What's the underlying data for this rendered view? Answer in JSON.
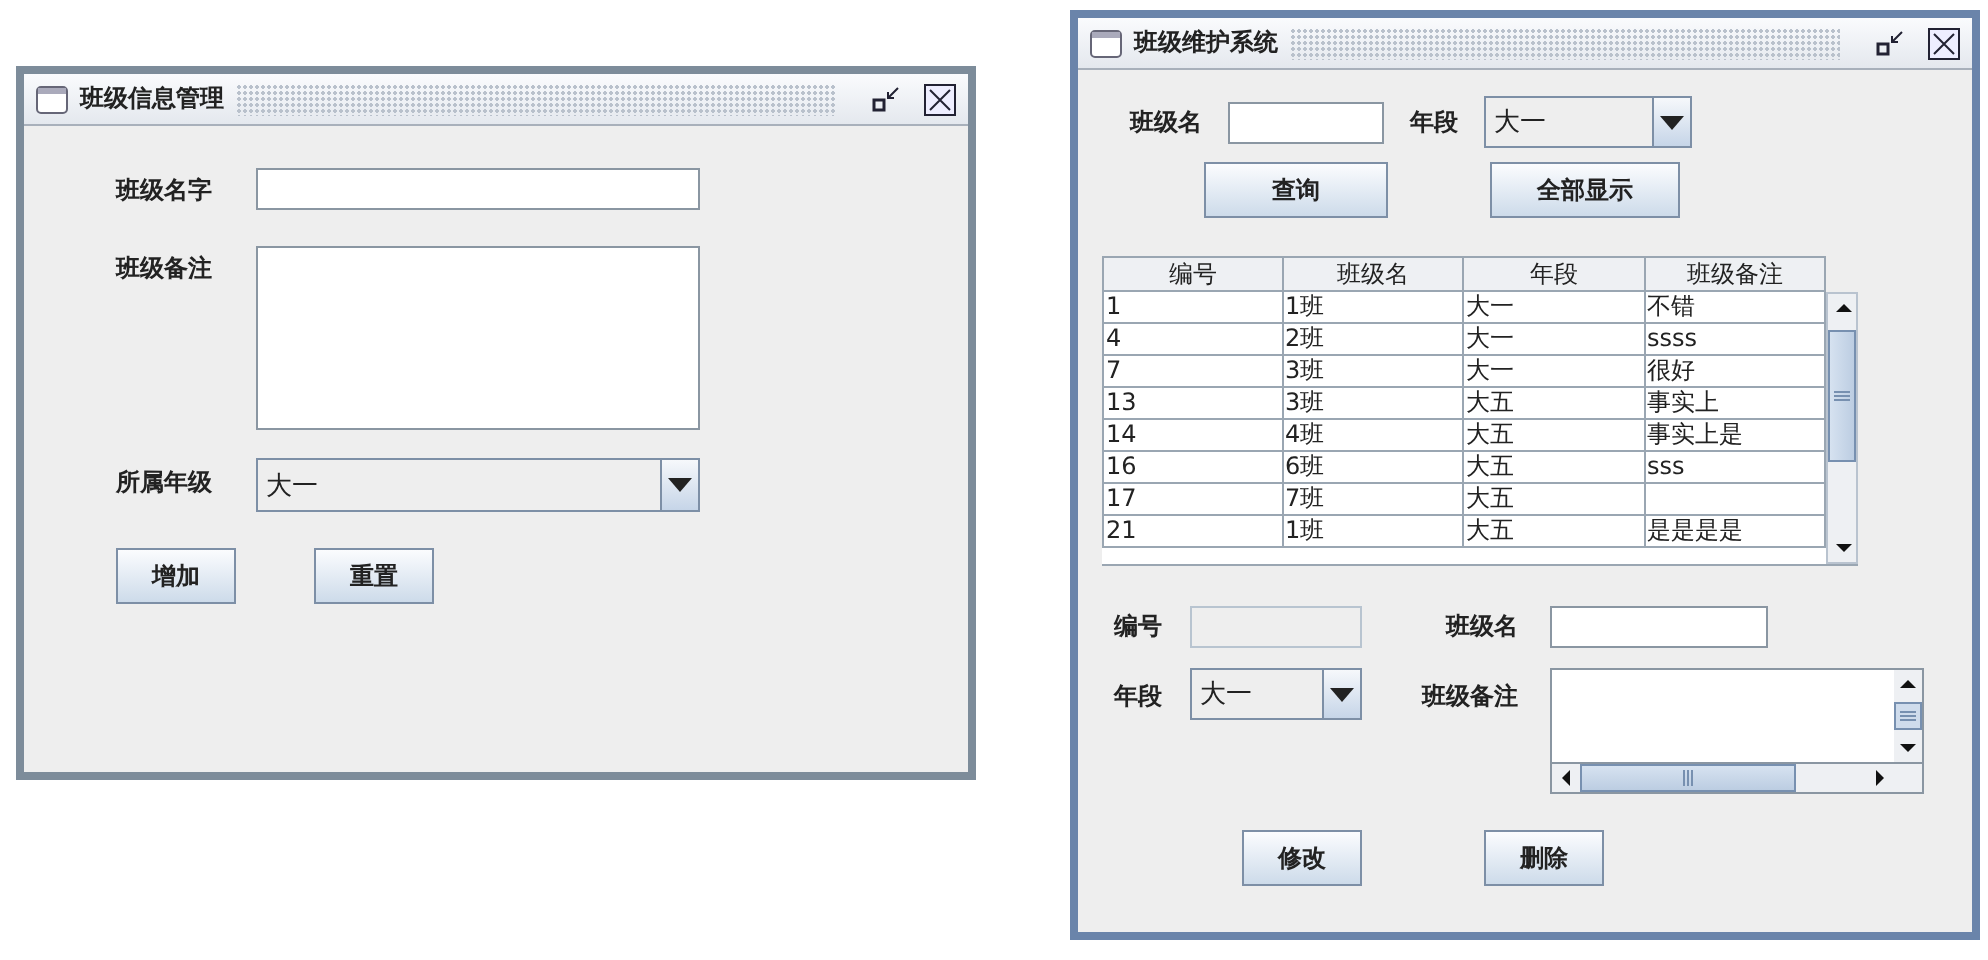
{
  "add_window": {
    "title": "班级信息管理",
    "fields": [
      {
        "kind": "text",
        "label": "班级名字"
      },
      {
        "kind": "textarea",
        "label": "班级备注"
      },
      {
        "kind": "combo",
        "label": "所属年级",
        "value": "大一"
      }
    ],
    "buttons": [
      "增加",
      "重置"
    ]
  },
  "maintain_window": {
    "title": "班级维护系统",
    "search": {
      "name_label": "班级名",
      "grade_label": "年段",
      "grade_value": "大一"
    },
    "search_buttons": [
      "查询",
      "全部显示"
    ],
    "table": {
      "columns": [
        "编号",
        "班级名",
        "年段",
        "班级备注"
      ],
      "rows": [
        {
          "id": "1",
          "name": "1班",
          "grade": "大一",
          "remark": "不错"
        },
        {
          "id": "4",
          "name": "2班",
          "grade": "大一",
          "remark": "ssss"
        },
        {
          "id": "7",
          "name": "3班",
          "grade": "大一",
          "remark": "很好"
        },
        {
          "id": "13",
          "name": "3班",
          "grade": "大五",
          "remark": "事实上"
        },
        {
          "id": "14",
          "name": "4班",
          "grade": "大五",
          "remark": "事实上是"
        },
        {
          "id": "16",
          "name": "6班",
          "grade": "大五",
          "remark": "sss"
        },
        {
          "id": "17",
          "name": "7班",
          "grade": "大五"
        },
        {
          "id": "21",
          "name": "1班",
          "grade": "大五",
          "remark": "是是是是"
        }
      ]
    },
    "edit": {
      "id_label": "编号",
      "id_disabled": true,
      "name_label": "班级名",
      "grade_label": "年段",
      "grade_value": "大一",
      "remark_label": "班级备注"
    },
    "edit_buttons": [
      "修改",
      "删除"
    ]
  }
}
